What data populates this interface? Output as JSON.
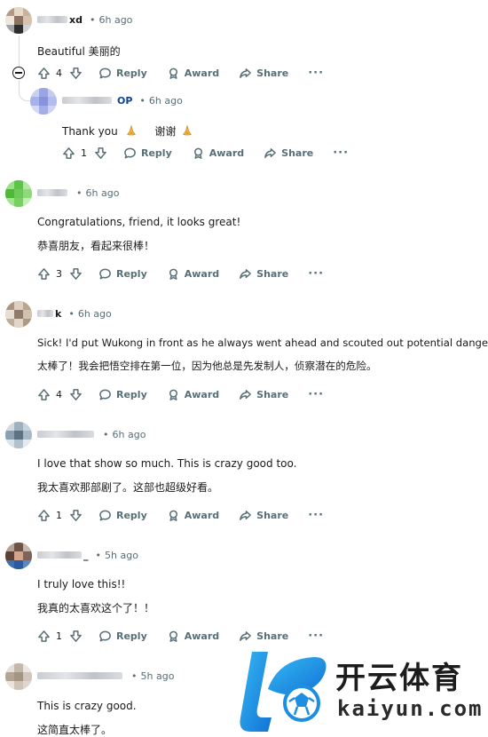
{
  "actions": {
    "reply": "Reply",
    "award": "Award",
    "share": "Share",
    "more": "···"
  },
  "comments": [
    {
      "username": "xd",
      "time": "6h ago",
      "lines": [
        "Beautiful   美丽的"
      ],
      "score": "4"
    },
    {
      "username": "",
      "op_label": "OP",
      "time": "6h ago",
      "lines": [
        "Thank you",
        "谢谢"
      ],
      "score": "1"
    },
    {
      "username": "",
      "time": "6h ago",
      "lines": [
        "Congratulations, friend, it looks great!",
        "恭喜朋友，看起来很棒！"
      ],
      "score": "3"
    },
    {
      "username": "k",
      "time": "6h ago",
      "lines": [
        "Sick! I'd put Wukong in front as he always went ahead and scouted out potential dangers.",
        "太棒了！我会把悟空排在第一位，因为他总是先发制人，侦察潜在的危险。"
      ],
      "score": "4"
    },
    {
      "username": "",
      "time": "6h ago",
      "lines": [
        "I love that show so much. This is crazy good too.",
        "我太喜欢那部剧了。这部也超级好看。"
      ],
      "score": "1"
    },
    {
      "username": "_",
      "time": "5h ago",
      "lines": [
        "I truly love this!!",
        "我真的太喜欢这个了！！"
      ],
      "score": "1"
    },
    {
      "username": "",
      "time": "5h ago",
      "lines": [
        "This is crazy good.",
        "这简直太棒了。"
      ]
    }
  ],
  "watermark": {
    "cn": "开云体育",
    "en": "kaiyun.com"
  },
  "colors": {
    "meta": "#576f76",
    "op": "#0a449b",
    "text": "#1a1a1b",
    "thread": "#d5dbe0",
    "watermark_blue": "#1e8fe0"
  },
  "icons": [
    "upvote-icon",
    "downvote-icon",
    "reply-icon",
    "award-icon",
    "share-icon",
    "collapse-icon",
    "pray-emoji"
  ]
}
